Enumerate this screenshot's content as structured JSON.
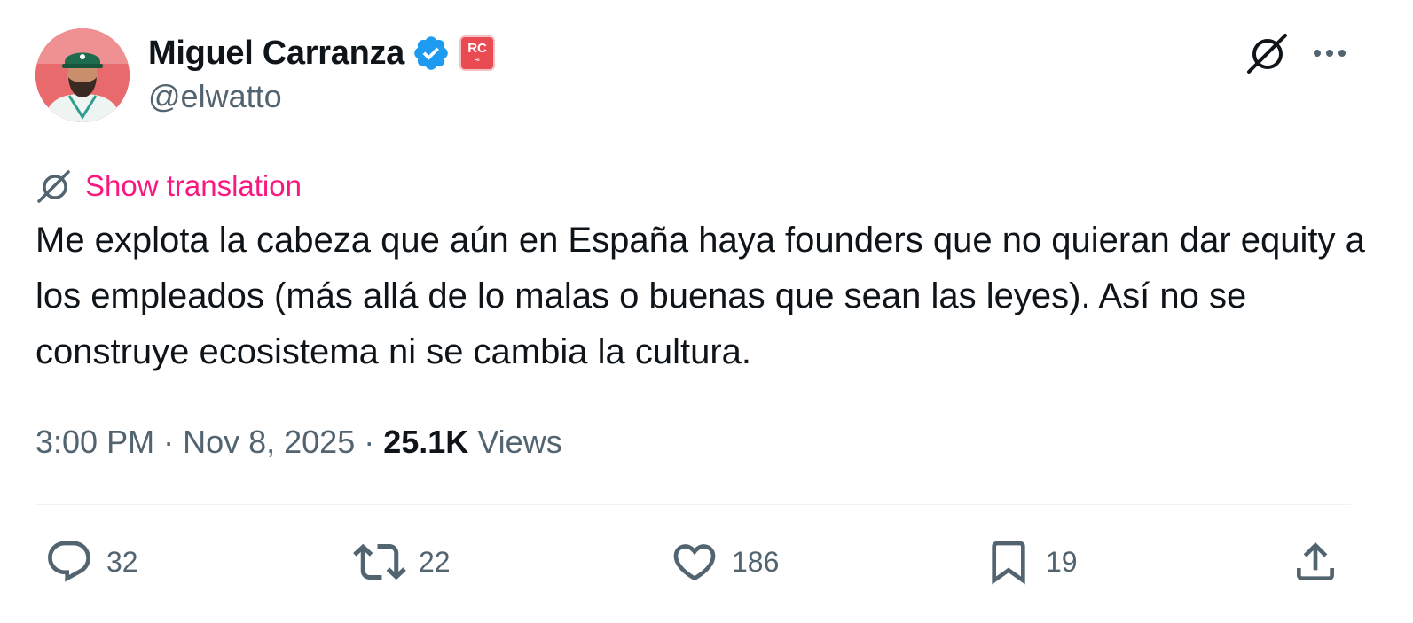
{
  "author": {
    "display_name": "Miguel Carranza",
    "handle": "@elwatto",
    "affiliate_badge": "RC",
    "verified_color": "#1d9bf0",
    "avatar_icon": "profile-photo"
  },
  "translation": {
    "label": "Show translation",
    "icon": "grok-icon",
    "color": "#f91880"
  },
  "tweet": {
    "text": "Me explota la cabeza que aún en España haya founders que no quieran dar equity a los empleados (más allá de lo malas o buenas que sean las leyes). Así no se construye ecosistema ni se cambia la cultura."
  },
  "meta": {
    "time": "3:00 PM",
    "date": "Nov 8, 2025",
    "separator": " · ",
    "views_count": "25.1K",
    "views_label": "Views"
  },
  "actions": {
    "replies": "32",
    "reposts": "22",
    "likes": "186",
    "bookmarks": "19"
  },
  "icons": {
    "top_right": [
      "grok-icon",
      "more-icon"
    ],
    "actions": [
      "reply-icon",
      "repost-icon",
      "like-icon",
      "bookmark-icon",
      "share-icon"
    ]
  },
  "colors": {
    "text_primary": "#0f1419",
    "text_secondary": "#536471",
    "divider": "#eff3f4",
    "badge_red": "#ea4a52"
  }
}
